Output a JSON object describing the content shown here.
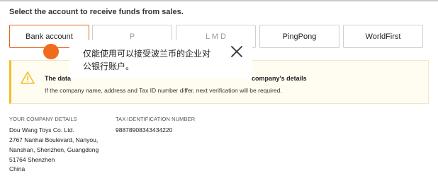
{
  "heading": "Select the account to receive funds from sales.",
  "tabs": [
    {
      "label": "Bank account",
      "active": true
    },
    {
      "label": "P",
      "active": false
    },
    {
      "label": "L    M    D",
      "active": false
    },
    {
      "label": "PingPong",
      "active": false
    },
    {
      "label": "WorldFirst",
      "active": false
    }
  ],
  "alert": {
    "icon": "warning-icon",
    "title_left": "The data",
    "title_right": "company's details",
    "body": "If the company name, address and Tax ID number differ, next verification will be required."
  },
  "company": {
    "label": "YOUR COMPANY DETAILS",
    "lines": [
      "Dou Wang Toys Co. Ltd.",
      "2767 Nanhai Boulevard, Nanyou,",
      "Nanshan, Shenzhen, Guangdong",
      "51764 Shenzhen",
      "China"
    ]
  },
  "tax": {
    "label": "TAX IDENTIFICATION NUMBER",
    "value": "98878908343434220"
  },
  "tooltip": {
    "text": "仅能使用可以接受波兰币的企业对公银行账户。",
    "close_icon": "close-icon"
  },
  "colors": {
    "accent": "#e8641b",
    "dot": "#f26a1b",
    "warning": "#f2be27",
    "alert_bg": "#fffcf2"
  }
}
